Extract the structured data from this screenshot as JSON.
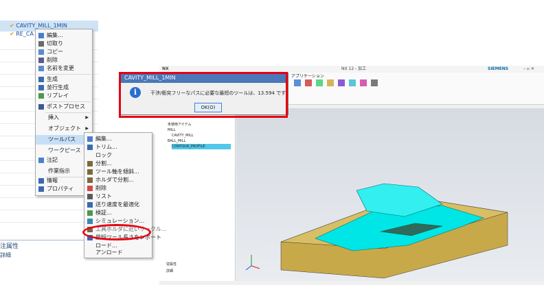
{
  "tree": {
    "item1": "CAVITY_MILL_1MIN",
    "item2": "RE_CA"
  },
  "menu_main": [
    {
      "label": "編集...",
      "icon": "edit-icon"
    },
    {
      "label": "切取り",
      "icon": "cut-icon"
    },
    {
      "label": "コピー",
      "icon": "copy-icon"
    },
    {
      "label": "削除",
      "icon": "delete-icon"
    },
    {
      "label": "名前を変更",
      "icon": "rename-icon"
    },
    {
      "label": "生成",
      "icon": "generate-icon"
    },
    {
      "label": "並行生成",
      "icon": "parallel-generate-icon"
    },
    {
      "label": "リプレイ",
      "icon": "replay-icon"
    },
    {
      "label": "ポストプロセス",
      "icon": "postprocess-icon"
    },
    {
      "label": "挿入",
      "icon": ""
    },
    {
      "label": "オブジェクト",
      "icon": ""
    },
    {
      "label": "ツールパス",
      "icon": ""
    },
    {
      "label": "ワークピース",
      "icon": ""
    },
    {
      "label": "注記",
      "icon": "note-icon"
    },
    {
      "label": "作業指示",
      "icon": ""
    },
    {
      "label": "情報",
      "icon": "info-icon"
    },
    {
      "label": "プロパティ",
      "icon": "properties-icon"
    }
  ],
  "menu_sub": [
    {
      "label": "編集..."
    },
    {
      "label": "トリム..."
    },
    {
      "label": "ロック"
    },
    {
      "label": "分割..."
    },
    {
      "label": "ツール軸を傾斜..."
    },
    {
      "label": "ホルダで分割..."
    },
    {
      "label": "削除"
    },
    {
      "label": "リスト"
    },
    {
      "label": "送り速度を最適化"
    },
    {
      "label": "検証..."
    },
    {
      "label": "シミュレーション..."
    },
    {
      "label": "工具ホルダに近いサークル..."
    },
    {
      "label": "最短ツール長さをレポート"
    },
    {
      "label": "ロード..."
    },
    {
      "label": "アンロード"
    }
  ],
  "properties": {
    "header": "注属性",
    "sub": "詳細"
  },
  "nx": {
    "title": "NX 12 - 加工",
    "brand": "SIEMENS",
    "ribbon_tab": "アプリケーション",
    "nav_items": [
      "未使用アイテム",
      "MILL",
      "CAVITY_MILL",
      "BALL_MILL",
      "CONTOUR_PROFILE"
    ],
    "nav_footer1": "従属性",
    "nav_footer2": "詳細"
  },
  "dialog": {
    "title": "CAVITY_MILL_1MIN",
    "message": "干渉/衝突フリーなパスに必要な最短のツールは、13.594 です",
    "ok": "OK(O)"
  },
  "colors": {
    "highlight": "#e60012",
    "part": "#00e5e5",
    "stock": "#c8a94a"
  }
}
